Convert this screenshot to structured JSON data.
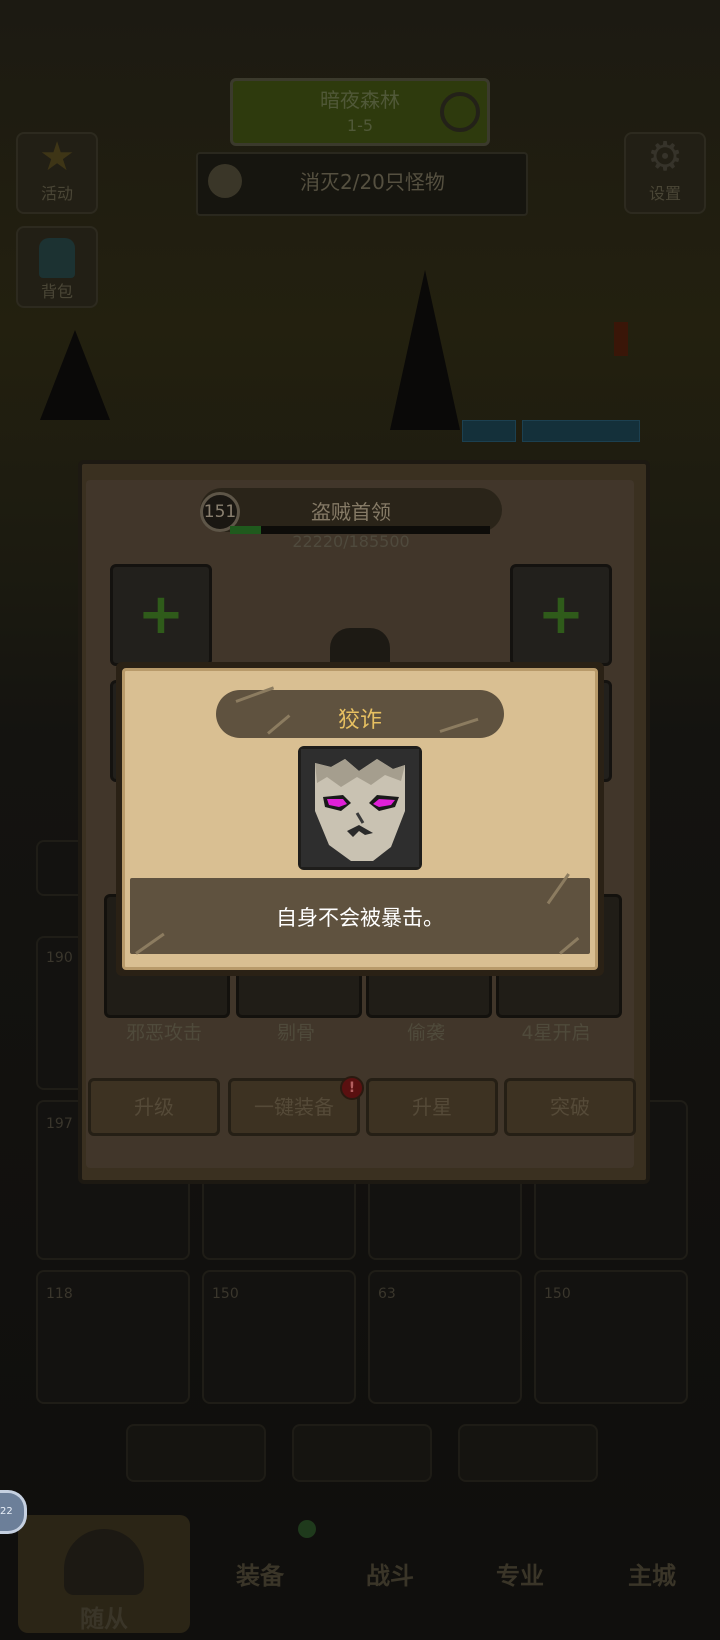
{
  "top": {
    "stage_title": "暗夜森林",
    "stage_sub": "1-5",
    "kill_progress": "消灭2/20只怪物",
    "left_buttons": [
      "活动",
      "背包"
    ],
    "right_button": "设置"
  },
  "hero": {
    "level": "151",
    "name": "盗贼首领",
    "xp_text": "22220/185500",
    "xp_fraction": 0.12,
    "skills": [
      "邪恶攻击",
      "剔骨",
      "偷袭",
      "4星开启"
    ],
    "actions": [
      "升级",
      "一键装备",
      "升星",
      "突破"
    ],
    "action_alert": "!"
  },
  "roster": {
    "levels": [
      "190",
      "197",
      "118",
      "150",
      "63",
      "150"
    ]
  },
  "popup": {
    "title": "狡诈",
    "icon": "sly-face-icon",
    "description": "自身不会被暴击。"
  },
  "nav": {
    "tabs": [
      "随从",
      "装备",
      "战斗",
      "专业",
      "主城"
    ],
    "notif_count": "22"
  },
  "colors": {
    "popup_bg": "#d9bf92",
    "banner": "#5f523f",
    "title_gold": "#e7c061",
    "eye_magenta": "#e020d8"
  }
}
